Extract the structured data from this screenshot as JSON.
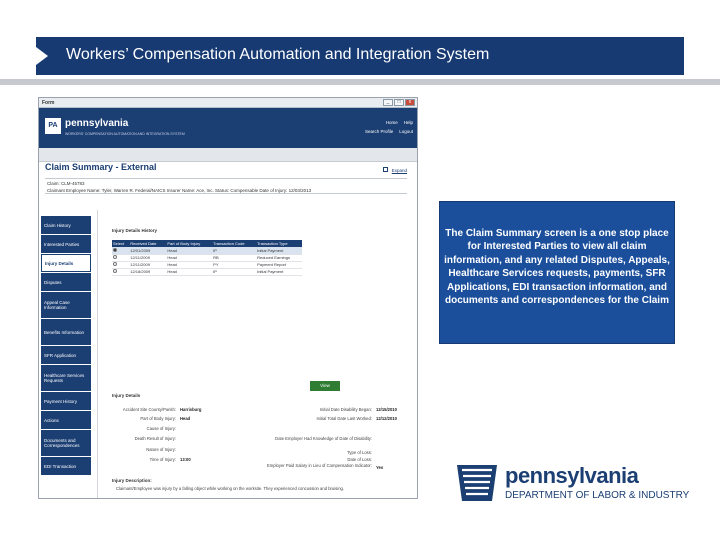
{
  "slide": {
    "title": "Workers’ Compensation Automation and Integration System",
    "callout": "The Claim Summary screen is a one stop place for Interested Parties to view all claim information, and any related Disputes, Appeals, Healthcare Services requests, payments, SFR Applications, EDI transaction information, and documents and correspondences for the Claim",
    "logo_name": "pennsylvania",
    "logo_dept": "DEPARTMENT OF LABOR & INDUSTRY"
  },
  "screenshot": {
    "window_title": "Form",
    "window_buttons": [
      "_",
      "□",
      "x"
    ],
    "pa_name": "pennsylvania",
    "pa_sub": "WORKERS' COMPENSATION AUTOMATION AND INTEGRATION SYSTEM",
    "links": [
      "Home",
      "Help",
      "Search Profile",
      "Logout"
    ],
    "page_title": "Claim Summary - External",
    "expand": "Expand",
    "claim_line1": "Claim: CLM-45783",
    "claim_line2": "Claimant Employee Name: Tyler, Warren R.   Federal/NAICS Insurer Name: Ace, Inc.   Status: Compensable   Date of Injury: 12/03/2013",
    "sidebar": [
      "Claim History",
      "Interested Parties",
      "Injury Details",
      "Disputes",
      "Appeal Case Information",
      "Benefits Information",
      "SFR Application",
      "Healthcare Services Requests",
      "Payment History",
      "Actions",
      "Documents and Correspondences",
      "EDI Transaction"
    ],
    "history_label": "Injury Details History",
    "history_headers": [
      "Select",
      "Received Date",
      "Part of Body Injury",
      "Transaction Code",
      "Transaction Type"
    ],
    "history_rows": [
      [
        "12/01/2009",
        "Head",
        "IP",
        "Initial Payment"
      ],
      [
        "12/11/2009",
        "Head",
        "RB",
        "Reduced Earnings"
      ],
      [
        "12/11/2009",
        "Head",
        "PY",
        "Payment Report"
      ],
      [
        "12/18/2009",
        "Head",
        "IP",
        "Initial Payment"
      ]
    ],
    "view_btn": "View",
    "details_label": "Injury Details",
    "left_fields": [
      {
        "k": "Accident Site County/Parish:",
        "v": "Harrisburg"
      },
      {
        "k": "Part of Body Injury:",
        "v": "Head"
      },
      {
        "k": "Cause of Injury:",
        "v": ""
      },
      {
        "k": "Death Result of Injury:",
        "v": ""
      },
      {
        "k": "Nature of Injury:",
        "v": ""
      },
      {
        "k": "Time of Injury:",
        "v": "13:00"
      }
    ],
    "right_fields": [
      {
        "k": "Initial Date Disability Began:",
        "v": "12/15/2010"
      },
      {
        "k": "Initial Total Date Last Worked:",
        "v": "12/12/2010"
      },
      {
        "k": "Date Employer Had Knowledge of Date of Disability:",
        "v": ""
      },
      {
        "k": "Type of Loss:",
        "v": ""
      },
      {
        "k": "Date of Loss:",
        "v": ""
      },
      {
        "k": "Employer Paid Salary in Lieu of Compensation Indicator:",
        "v": "Yes"
      }
    ],
    "desc_label": "Injury Description:",
    "desc_text": "Claimant/Employee was injury by a falling object while working on the worksite. They experienced concussion and bruising."
  }
}
